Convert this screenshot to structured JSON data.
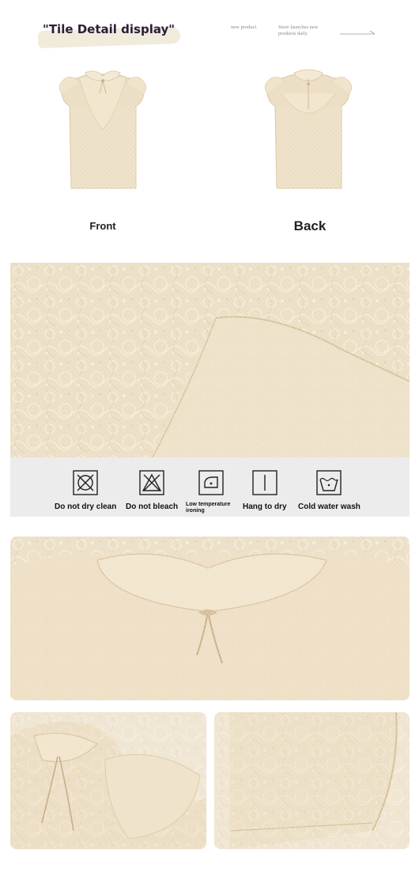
{
  "header": {
    "title": "\"Tile Detail display\"",
    "new_product": "new product",
    "store_note": "Store launches new products daily",
    "arrow_icon": "long-arrow-right-icon"
  },
  "views": {
    "front_label": "Front",
    "back_label": "Back"
  },
  "care": {
    "items": [
      {
        "label": "Do not dry clean",
        "icon": "no-dry-clean-icon"
      },
      {
        "label": "Do not bleach",
        "icon": "no-bleach-icon"
      },
      {
        "label": "Low temperature ironing",
        "icon": "low-temp-iron-icon"
      },
      {
        "label": "Hang to dry",
        "icon": "hang-dry-icon"
      },
      {
        "label": "Cold water wash",
        "icon": "cold-wash-icon"
      }
    ]
  },
  "colors": {
    "fabric": "#efe3cc",
    "fabric_shadow": "#e2d1b2",
    "lace_line": "#f8f1e2",
    "title_text": "#2a1f3d",
    "care_band": "#ececec"
  }
}
